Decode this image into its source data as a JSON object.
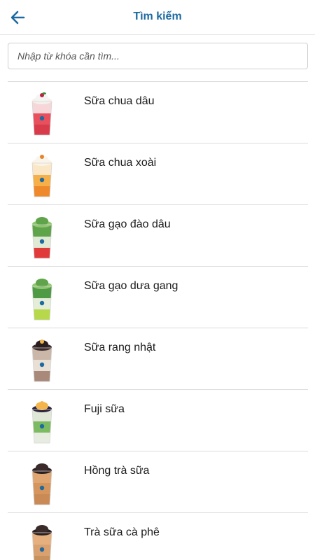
{
  "header": {
    "title": "Tìm kiếm",
    "back_icon": "arrow-left-icon"
  },
  "search": {
    "placeholder": "Nhập từ khóa cần tìm...",
    "value": ""
  },
  "colors": {
    "accent": "#1e6aa0"
  },
  "products": [
    {
      "name": "Sữa chua dâu",
      "style": "strawberry-yogurt"
    },
    {
      "name": "Sữa chua xoài",
      "style": "mango-yogurt"
    },
    {
      "name": "Sữa gạo đào dâu",
      "style": "green-red"
    },
    {
      "name": "Sữa gạo dưa gang",
      "style": "green-lime"
    },
    {
      "name": "Sữa rang nhật",
      "style": "brown-layers"
    },
    {
      "name": "Fuji sữa",
      "style": "green-layers"
    },
    {
      "name": "Hồng trà sữa",
      "style": "milk-tea"
    },
    {
      "name": "Trà sữa cà phê",
      "style": "coffee-milk-tea"
    }
  ]
}
